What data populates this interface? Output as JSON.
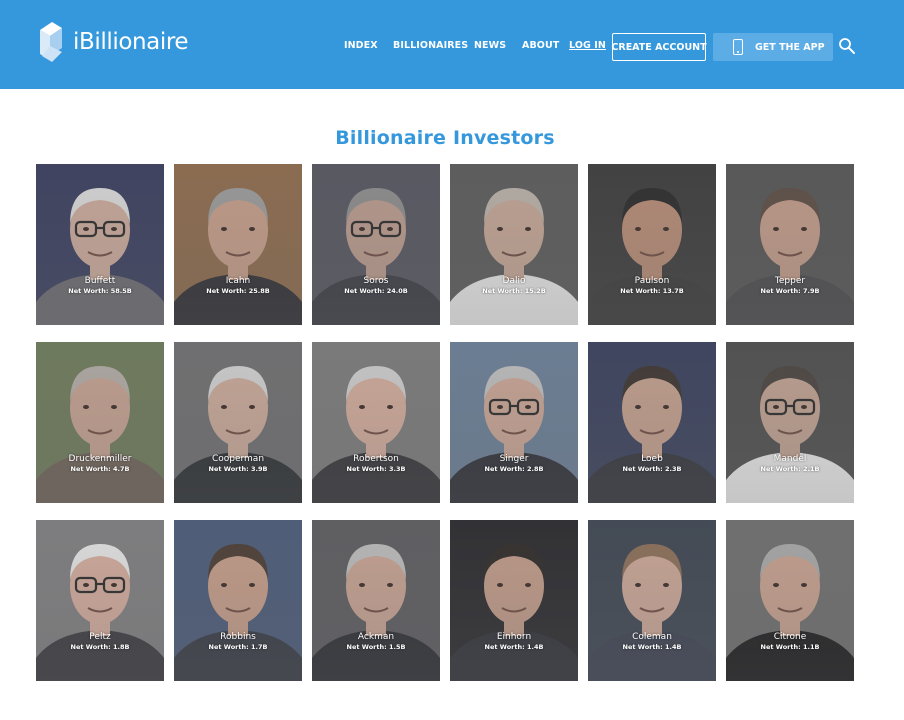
{
  "header": {
    "background": "#3598dc",
    "logo_text": "iBillionaire",
    "nav": [
      {
        "label": "INDEX"
      },
      {
        "label": "BILLIONAIRES"
      },
      {
        "label": "NEWS"
      },
      {
        "label": "ABOUT"
      },
      {
        "label": "LOG IN"
      }
    ],
    "create_account_label": "CREATE ACCOUNT",
    "get_app_label": "GET THE APP",
    "icons": [
      "logo-mark-icon",
      "phone-icon",
      "search-icon"
    ]
  },
  "main": {
    "title": "Billionaire Investors",
    "investors": [
      {
        "name": "Buffett",
        "net_worth": "Net Worth: 58.5B",
        "bg": "#3a3e5e",
        "skin": "#c9a89a",
        "hair": "#d8d8d8",
        "suit": "#6a6a70",
        "glasses": true
      },
      {
        "name": "Icahn",
        "net_worth": "Net Worth: 25.8B",
        "bg": "#8c6a4c",
        "skin": "#c49c88",
        "hair": "#9a9a9a",
        "suit": "#2e2e34",
        "glasses": false
      },
      {
        "name": "Soros",
        "net_worth": "Net Worth: 24.0B",
        "bg": "#555560",
        "skin": "#b8998c",
        "hair": "#8c8c8c",
        "suit": "#3a3c44",
        "glasses": true
      },
      {
        "name": "Dalio",
        "net_worth": "Net Worth: 15.2B",
        "bg": "#5a5a5a",
        "skin": "#c2a494",
        "hair": "#b8b0a8",
        "suit": "#e6e6e6",
        "glasses": false
      },
      {
        "name": "Paulson",
        "net_worth": "Net Worth: 13.7B",
        "bg": "#3c3c3c",
        "skin": "#b58a74",
        "hair": "#2a2a2a",
        "suit": "#3a3a3a",
        "glasses": false
      },
      {
        "name": "Tepper",
        "net_worth": "Net Worth: 7.9B",
        "bg": "#555555",
        "skin": "#c09a88",
        "hair": "#5a4c44",
        "suit": "#4a4a4e",
        "glasses": false
      },
      {
        "name": "Druckenmiller",
        "net_worth": "Net Worth: 4.7B",
        "bg": "#6d7a5a",
        "skin": "#c3a090",
        "hair": "#b0aaa4",
        "suit": "#6e6258",
        "glasses": false
      },
      {
        "name": "Cooperman",
        "net_worth": "Net Worth: 3.9B",
        "bg": "#6e6e70",
        "skin": "#c8a898",
        "hair": "#d0d0d0",
        "suit": "#2c3034",
        "glasses": false
      },
      {
        "name": "Robertson",
        "net_worth": "Net Worth: 3.3B",
        "bg": "#7a7a7a",
        "skin": "#d0aa9a",
        "hair": "#cccccc",
        "suit": "#35353a",
        "glasses": false
      },
      {
        "name": "Singer",
        "net_worth": "Net Worth: 2.8B",
        "bg": "#6a7e96",
        "skin": "#c8a494",
        "hair": "#bdbdbd",
        "suit": "#2e3038",
        "glasses": true
      },
      {
        "name": "Loeb",
        "net_worth": "Net Worth: 2.3B",
        "bg": "#39405c",
        "skin": "#c29e8c",
        "hair": "#3c3430",
        "suit": "#33353c",
        "glasses": false
      },
      {
        "name": "Mandel",
        "net_worth": "Net Worth: 2.1B",
        "bg": "#4e4e4e",
        "skin": "#bea090",
        "hair": "#4a4440",
        "suit": "#e8e8e8",
        "glasses": true
      },
      {
        "name": "Peltz",
        "net_worth": "Net Worth: 1.8B",
        "bg": "#7e7e80",
        "skin": "#d2aa9c",
        "hair": "#e4e4e4",
        "suit": "#3a3a40",
        "glasses": true
      },
      {
        "name": "Robbins",
        "net_worth": "Net Worth: 1.7B",
        "bg": "#4a5a78",
        "skin": "#c49c88",
        "hair": "#4a3c34",
        "suit": "#363a44",
        "glasses": false
      },
      {
        "name": "Ackman",
        "net_worth": "Net Worth: 1.5B",
        "bg": "#5c5c60",
        "skin": "#c6a292",
        "hair": "#bcbcbc",
        "suit": "#2c2e34",
        "glasses": false
      },
      {
        "name": "Einhorn",
        "net_worth": "Net Worth: 1.4B",
        "bg": "#2a2a2e",
        "skin": "#c09a88",
        "hair": "#2e2a28",
        "suit": "#30323a",
        "glasses": false
      },
      {
        "name": "Coleman",
        "net_worth": "Net Worth: 1.4B",
        "bg": "#3e4652",
        "skin": "#caa696",
        "hair": "#8a6e58",
        "suit": "#3c4252",
        "glasses": false
      },
      {
        "name": "Citrone",
        "net_worth": "Net Worth: 1.1B",
        "bg": "#6e6e6e",
        "skin": "#c6a08e",
        "hair": "#a8a8a8",
        "suit": "#1c1c1e",
        "glasses": false
      }
    ]
  }
}
